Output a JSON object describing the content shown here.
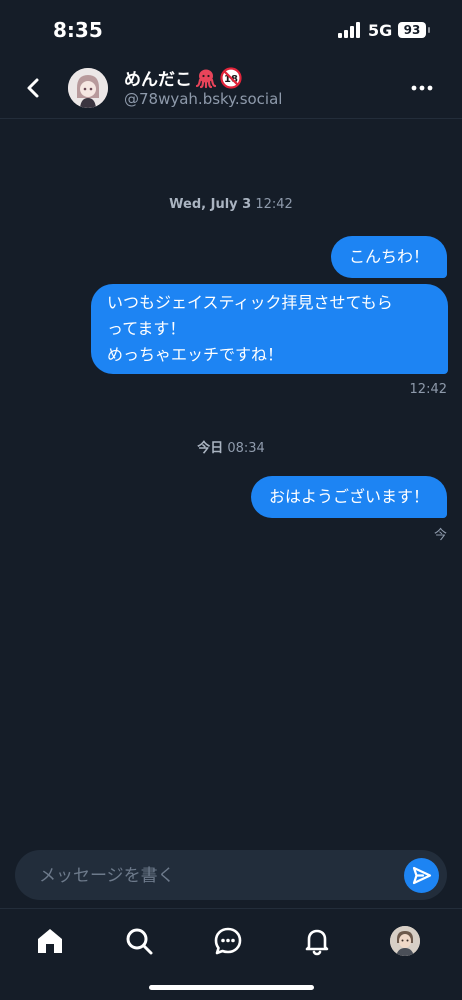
{
  "status_bar": {
    "time": "8:35",
    "network": "5G",
    "battery": "93"
  },
  "header": {
    "contact_name": "めんだこ",
    "contact_handle": "@78wyah.bsky.social",
    "badges": [
      "octopus-emoji",
      "r18-emoji"
    ]
  },
  "conversation": {
    "sections": [
      {
        "date_bold": "Wed, July 3",
        "date_time": "12:42",
        "messages": [
          {
            "lines": [
              "こんちわ！"
            ]
          },
          {
            "lines": [
              "いつもジェイスティック拝見させてもら",
              "ってます！",
              "めっちゃエッチですね！"
            ],
            "time": "12:42"
          }
        ]
      },
      {
        "date_bold": "今日",
        "date_time": "08:34",
        "messages": [
          {
            "lines": [
              "おはようございます！"
            ],
            "time": "今"
          }
        ]
      }
    ]
  },
  "composer": {
    "placeholder": "メッセージを書く",
    "value": ""
  },
  "tab_bar": {
    "items": [
      "home-icon",
      "search-icon",
      "chat-icon",
      "bell-icon",
      "profile-avatar"
    ]
  },
  "colors": {
    "background": "#151d28",
    "bubble": "#1d84f3",
    "accent": "#1d84f3",
    "muted_text": "#8e9aab"
  }
}
